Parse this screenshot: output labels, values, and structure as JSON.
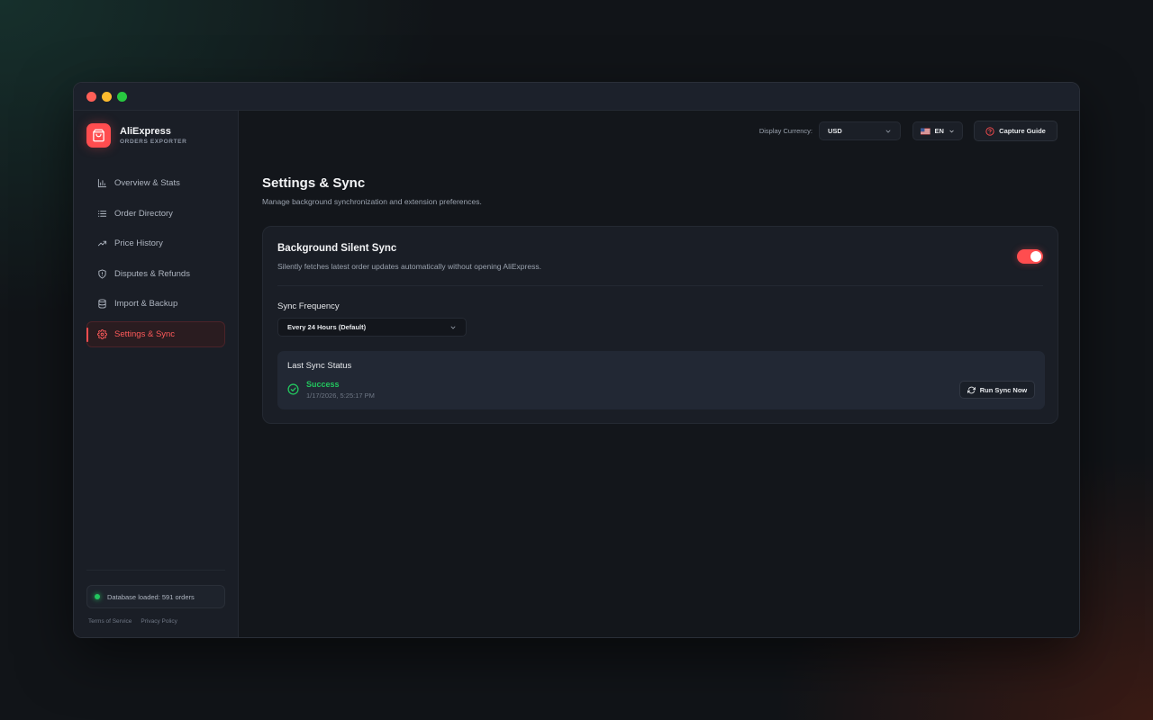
{
  "brand": {
    "name": "AliExpress",
    "subtitle": "ORDERS EXPORTER"
  },
  "sidebar": {
    "items": [
      {
        "label": "Overview & Stats",
        "icon": "bar-chart-icon"
      },
      {
        "label": "Order Directory",
        "icon": "list-icon"
      },
      {
        "label": "Price History",
        "icon": "trending-up-icon"
      },
      {
        "label": "Disputes & Refunds",
        "icon": "shield-alert-icon"
      },
      {
        "label": "Import & Backup",
        "icon": "database-icon"
      },
      {
        "label": "Settings & Sync",
        "icon": "gear-icon",
        "active": true
      }
    ],
    "db_status": "Database loaded: 591 orders",
    "terms": "Terms of Service",
    "privacy": "Privacy Policy"
  },
  "topbar": {
    "currency_label": "Display Currency:",
    "currency_value": "USD",
    "language": "EN",
    "guide_label": "Capture Guide"
  },
  "page": {
    "title": "Settings & Sync",
    "subtitle": "Manage background synchronization and extension preferences."
  },
  "sync": {
    "title": "Background Silent Sync",
    "description": "Silently fetches latest order updates automatically without opening AliExpress.",
    "enabled": true,
    "frequency_label": "Sync Frequency",
    "frequency_value": "Every 24 Hours (Default)",
    "last_status_title": "Last Sync Status",
    "last_status": "Success",
    "last_time": "1/17/2026, 5:25:17 PM",
    "run_label": "Run Sync Now"
  },
  "colors": {
    "accent": "#ff4d4f",
    "success": "#22c55e",
    "background": "#13161b",
    "sidebar": "#1a1e26"
  }
}
